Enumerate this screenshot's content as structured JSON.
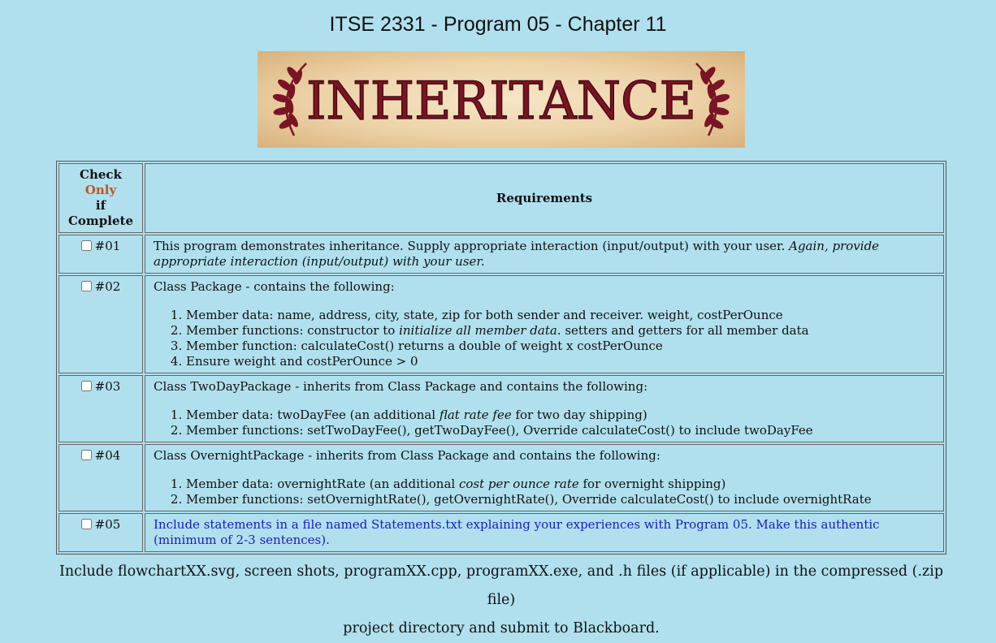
{
  "page": {
    "title": "ITSE 2331 - Program 05 - Chapter 11",
    "banner_text": "INHERITANCE"
  },
  "table": {
    "header": {
      "check_prefix": "Check",
      "check_only": "Only",
      "check_suffix": "if Complete",
      "requirements": "Requirements"
    },
    "rows": [
      {
        "num": "#01",
        "text": "This program demonstrates inheritance. Supply appropriate interaction (input/output) with your user.",
        "italic": "Again, provide appropriate interaction (input/output) with your user."
      },
      {
        "num": "#02",
        "intro": "Class Package - contains the following:",
        "items": {
          "i1": "Member data: name, address, city, state, zip for both sender and receiver. weight, costPerOunce",
          "i2_a": "Member functions: constructor to ",
          "i2_em": "initialize all member data.",
          "i2_b": " setters and getters for all member data",
          "i3": "Member function: calculateCost() returns a double of weight x costPerOunce",
          "i4": "Ensure weight and costPerOunce > 0"
        }
      },
      {
        "num": "#03",
        "intro": "Class TwoDayPackage - inherits from Class Package and contains the following:",
        "items": {
          "i1_a": "Member data: twoDayFee (an additional ",
          "i1_em": "flat rate fee",
          "i1_b": " for two day shipping)",
          "i2": "Member functions: setTwoDayFee(), getTwoDayFee(), Override calculateCost() to include twoDayFee"
        }
      },
      {
        "num": "#04",
        "intro": "Class OvernightPackage - inherits from Class Package and contains the following:",
        "items": {
          "i1_a": "Member data: overnightRate (an additional ",
          "i1_em": "cost per ounce rate",
          "i1_b": " for overnight shipping)",
          "i2": "Member functions: setOvernightRate(), getOvernightRate(), Override calculateCost() to include overnightRate"
        }
      },
      {
        "num": "#05",
        "text": "Include statements in a file named Statements.txt explaining your experiences with Program 05. Make this authentic (minimum of 2-3 sentences)."
      }
    ]
  },
  "footer": {
    "line1": "Include flowchartXX.svg, screen shots, programXX.cpp, programXX.exe, and .h files (if applicable) in the compressed (.zip file)",
    "line2": "project directory and submit to Blackboard."
  },
  "colors": {
    "background": "#b0e0ee",
    "only_accent": "#c0561b",
    "link_blue": "#1a1ac8",
    "banner_text": "#7a1424"
  },
  "icons": {
    "banner_left": "laurel-branch-icon",
    "banner_right": "laurel-branch-icon"
  }
}
